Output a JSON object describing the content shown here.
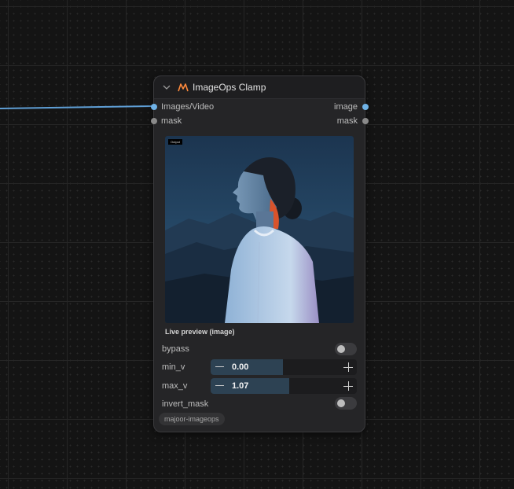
{
  "node": {
    "title": "ImageOps Clamp",
    "inputs": [
      {
        "label": "Images/Video",
        "color": "#6fb2e6"
      },
      {
        "label": "mask",
        "color": "#8a8a8a"
      }
    ],
    "outputs": [
      {
        "label": "image",
        "color": "#6fb2e6"
      },
      {
        "label": "mask",
        "color": "#8a8a8a"
      }
    ],
    "preview": {
      "badge": "Output",
      "caption": "Live preview (image)"
    },
    "widgets": {
      "bypass": {
        "label": "bypass",
        "value": false
      },
      "min_v": {
        "label": "min_v",
        "value": "0.00"
      },
      "max_v": {
        "label": "max_v",
        "value": "1.07"
      },
      "invert_mask": {
        "label": "invert_mask",
        "value": false
      }
    },
    "tag": "majoor-imageops"
  },
  "colors": {
    "wire": "#5f9fd6",
    "accent_logo": "#ff8a3c"
  }
}
